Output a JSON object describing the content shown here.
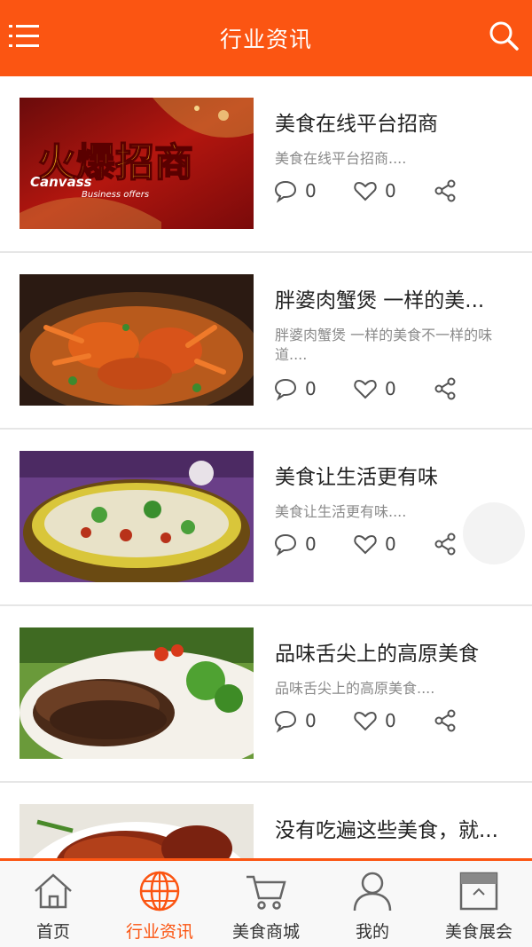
{
  "header": {
    "title": "行业资讯",
    "menu_icon": "menu-icon",
    "search_icon": "search-icon",
    "bg_color": "#fb5512"
  },
  "articles": [
    {
      "title": "美食在线平台招商",
      "desc": "美食在线平台招商....",
      "comments": "0",
      "likes": "0",
      "image": "火爆招商 banner"
    },
    {
      "title": "胖婆肉蟹煲 一样的美...",
      "desc": "胖婆肉蟹煲 一样的美食不一样的味道....",
      "comments": "0",
      "likes": "0",
      "image": "crab pot"
    },
    {
      "title": "美食让生活更有味",
      "desc": "美食让生活更有味....",
      "comments": "0",
      "likes": "0",
      "image": "fish soup"
    },
    {
      "title": "品味舌尖上的高原美食",
      "desc": "品味舌尖上的高原美食....",
      "comments": "0",
      "likes": "0",
      "image": "sliced beef"
    },
    {
      "title": "没有吃遍这些美食，就...",
      "desc": "",
      "comments": "",
      "likes": "",
      "image": "braised pork"
    }
  ],
  "banner_text": {
    "main": "火爆招商",
    "sub1": "Canvass",
    "sub2": "Business offers"
  },
  "tabbar": {
    "active_color": "#fb5512",
    "tabs": [
      {
        "label": "首页",
        "icon": "home-icon"
      },
      {
        "label": "行业资讯",
        "icon": "globe-icon",
        "active": true
      },
      {
        "label": "美食商城",
        "icon": "cart-icon"
      },
      {
        "label": "我的",
        "icon": "user-icon"
      },
      {
        "label": "美食展会",
        "icon": "store-icon"
      }
    ]
  }
}
